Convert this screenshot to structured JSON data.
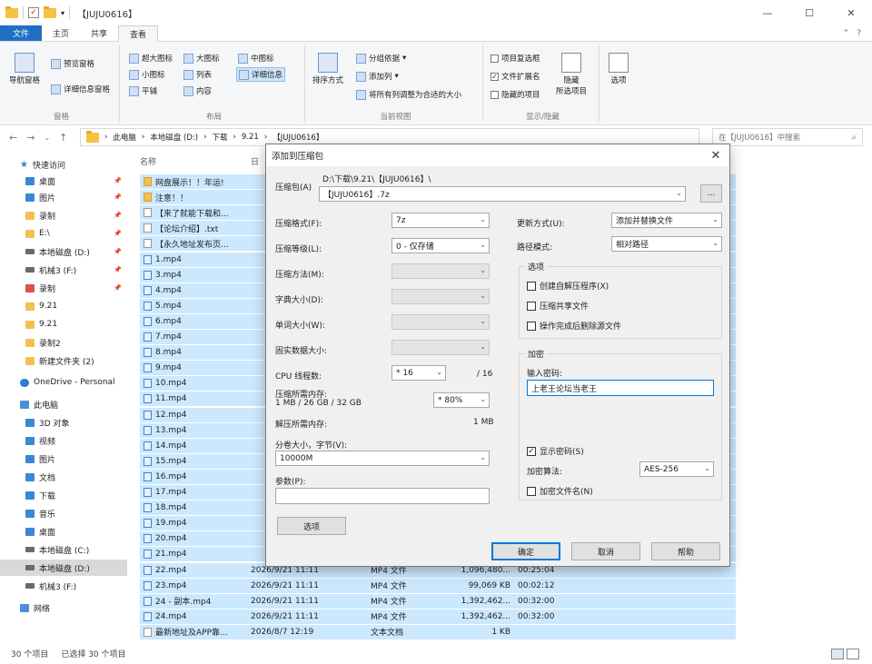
{
  "window": {
    "title": "【JUJU0616】",
    "min": "—",
    "max": "☐",
    "close": "✕"
  },
  "tabs": [
    "文件",
    "主页",
    "共享",
    "查看"
  ],
  "ribbon": {
    "panes": {
      "nav_pane": "导航窗格",
      "preview": "预览窗格",
      "details": "详细信息窗格",
      "label": "窗格"
    },
    "layout": {
      "items": [
        "超大图标",
        "大图标",
        "中图标",
        "小图标",
        "列表",
        "详细信息",
        "平铺",
        "内容"
      ],
      "label": "布局"
    },
    "current_view": {
      "sort": "排序方式",
      "group": "分组依据",
      "add_col": "添加列",
      "fit_cols": "将所有列调整为合适的大小",
      "label": "当前视图"
    },
    "show_hide": {
      "item_checkbox": "项目复选框",
      "extensions": "文件扩展名",
      "hidden_items": "隐藏的项目",
      "hide_selected": "隐藏\n所选项目",
      "label": "显示/隐藏"
    },
    "options": "选项"
  },
  "address": {
    "crumbs": [
      "此电脑",
      "本地磁盘 (D:)",
      "下载",
      "9.21",
      "【JUJU0616】"
    ],
    "search_placeholder": "在【JUJU0616】中搜索"
  },
  "nav_pane": [
    {
      "label": "快速访问",
      "icon": "star",
      "indent": 0
    },
    {
      "label": "桌面",
      "icon": "blue",
      "pin": true
    },
    {
      "label": "图片",
      "icon": "blue",
      "pin": true
    },
    {
      "label": "录制",
      "icon": "yellow",
      "pin": true
    },
    {
      "label": "E:\\",
      "icon": "yellow",
      "pin": true
    },
    {
      "label": "本地磁盘 (D:)",
      "icon": "drive",
      "pin": true
    },
    {
      "label": "机械3 (F:)",
      "icon": "drive",
      "pin": true
    },
    {
      "label": "录制",
      "icon": "red",
      "pin": true
    },
    {
      "label": "9.21",
      "icon": "yellow"
    },
    {
      "label": "9.21",
      "icon": "yellow"
    },
    {
      "label": "录制2",
      "icon": "yellow"
    },
    {
      "label": "新建文件夹 (2)",
      "icon": "yellow"
    },
    {
      "label": "OneDrive - Personal",
      "icon": "cloud",
      "indent": 0
    },
    {
      "label": "此电脑",
      "icon": "pc",
      "indent": 0
    },
    {
      "label": "3D 对象",
      "icon": "blue"
    },
    {
      "label": "视频",
      "icon": "blue"
    },
    {
      "label": "图片",
      "icon": "blue"
    },
    {
      "label": "文档",
      "icon": "blue"
    },
    {
      "label": "下载",
      "icon": "blue"
    },
    {
      "label": "音乐",
      "icon": "blue"
    },
    {
      "label": "桌面",
      "icon": "blue"
    },
    {
      "label": "本地磁盘 (C:)",
      "icon": "drive"
    },
    {
      "label": "本地磁盘 (D:)",
      "icon": "drive",
      "selected": true
    },
    {
      "label": "机械3 (F:)",
      "icon": "drive"
    },
    {
      "label": "网络",
      "icon": "pc",
      "indent": 0
    }
  ],
  "file_headers": {
    "name": "名称",
    "date": "日"
  },
  "files": [
    {
      "name": "网盘展示！！年运!",
      "icon": "f"
    },
    {
      "name": "注意！！",
      "icon": "f"
    },
    {
      "name": "【来了就能下载和...",
      "icon": "t"
    },
    {
      "name": "【论坛介绍】.txt",
      "icon": "t"
    },
    {
      "name": "【永久地址发布页...",
      "icon": "t"
    },
    {
      "name": "1.mp4",
      "icon": "m"
    },
    {
      "name": "3.mp4",
      "icon": "m"
    },
    {
      "name": "4.mp4",
      "icon": "m"
    },
    {
      "name": "5.mp4",
      "icon": "m"
    },
    {
      "name": "6.mp4",
      "icon": "m"
    },
    {
      "name": "7.mp4",
      "icon": "m"
    },
    {
      "name": "8.mp4",
      "icon": "m"
    },
    {
      "name": "9.mp4",
      "icon": "m"
    },
    {
      "name": "10.mp4",
      "icon": "m"
    },
    {
      "name": "11.mp4",
      "icon": "m"
    },
    {
      "name": "12.mp4",
      "icon": "m"
    },
    {
      "name": "13.mp4",
      "icon": "m"
    },
    {
      "name": "14.mp4",
      "icon": "m"
    },
    {
      "name": "15.mp4",
      "icon": "m"
    },
    {
      "name": "16.mp4",
      "icon": "m"
    },
    {
      "name": "17.mp4",
      "icon": "m"
    },
    {
      "name": "18.mp4",
      "icon": "m"
    },
    {
      "name": "19.mp4",
      "icon": "m"
    },
    {
      "name": "20.mp4",
      "icon": "m"
    },
    {
      "name": "21.mp4",
      "icon": "m"
    },
    {
      "name": "22.mp4",
      "icon": "m",
      "date": "2026/9/21 11:11",
      "type": "MP4 文件",
      "size": "1,096,480...",
      "dur": "00:25:04"
    },
    {
      "name": "23.mp4",
      "icon": "m",
      "date": "2026/9/21 11:11",
      "type": "MP4 文件",
      "size": "99,069 KB",
      "dur": "00:02:12"
    },
    {
      "name": "24 - 副本.mp4",
      "icon": "m",
      "date": "2026/9/21 11:11",
      "type": "MP4 文件",
      "size": "1,392,462...",
      "dur": "00:32:00"
    },
    {
      "name": "24.mp4",
      "icon": "m",
      "date": "2026/9/21 11:11",
      "type": "MP4 文件",
      "size": "1,392,462...",
      "dur": "00:32:00"
    },
    {
      "name": "最新地址及APP靠...",
      "icon": "t",
      "date": "2026/8/7 12:19",
      "type": "文本文档",
      "size": "1 KB",
      "dur": ""
    }
  ],
  "status": {
    "count": "30 个项目",
    "selected": "已选择 30 个项目"
  },
  "dialog": {
    "title": "添加到压缩包",
    "close": "✕",
    "archive_label": "压缩包(A)",
    "archive_path": "D:\\下载\\9.21\\【JUJU0616】\\",
    "archive_name": "【JUJU0616】.7z",
    "browse": "...",
    "format_label": "压缩格式(F):",
    "format_value": "7z",
    "level_label": "压缩等级(L):",
    "level_value": "0 - 仅存储",
    "method_label": "压缩方法(M):",
    "dict_label": "字典大小(D):",
    "word_label": "单词大小(W):",
    "solid_label": "固实数据大小:",
    "cpu_label": "CPU 线程数:",
    "cpu_value": "* 16",
    "cpu_total": "/ 16",
    "mem_label": "压缩所需内存:",
    "mem_detail": "1 MB / 26 GB / 32 GB",
    "mem_value": "* 80%",
    "dmem_label": "解压所需内存:",
    "dmem_value": "1 MB",
    "split_label": "分卷大小，字节(V):",
    "split_value": "10000M",
    "params_label": "参数(P):",
    "options_btn": "选项",
    "update_label": "更新方式(U):",
    "update_value": "添加并替换文件",
    "path_label": "路径模式:",
    "path_value": "相对路径",
    "opts_title": "选项",
    "opt_sfx": "创建自解压程序(X)",
    "opt_shared": "压缩共享文件",
    "opt_delete": "操作完成后删除源文件",
    "enc_title": "加密",
    "pwd_label": "输入密码:",
    "pwd_value": "上老王论坛当老王",
    "show_pwd": "显示密码(S)",
    "enc_method_label": "加密算法:",
    "enc_method_value": "AES-256",
    "enc_names": "加密文件名(N)",
    "ok": "确定",
    "cancel": "取消",
    "help": "帮助"
  }
}
